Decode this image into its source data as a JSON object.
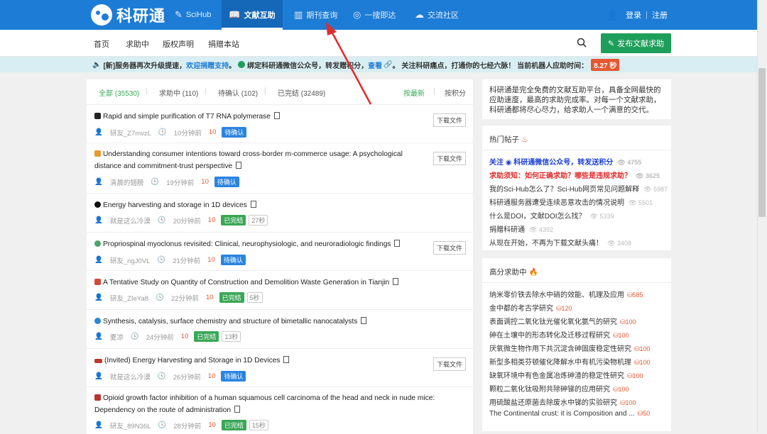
{
  "brand": {
    "name": "科研通"
  },
  "topnav": {
    "items": [
      {
        "label": "SciHub",
        "icon": "scihub-icon"
      },
      {
        "label": "文献互助",
        "icon": "book-icon",
        "active": true
      },
      {
        "label": "期刊查询",
        "icon": "journal-icon"
      },
      {
        "label": "一搜即达",
        "icon": "search-icon"
      },
      {
        "label": "交流社区",
        "icon": "chat-icon"
      }
    ],
    "login": "登录",
    "sep": "|",
    "register": "注册"
  },
  "subnav": {
    "items": [
      "首页",
      "求助中",
      "版权声明",
      "捐赠本站"
    ],
    "publish": "发布文献求助"
  },
  "notice": {
    "p1": "[新]服务器再次升级提速，",
    "p2": "欢迎捐赠支持",
    "p3": "。",
    "p4": "绑定科研通微信公众号，转发赠积分，",
    "p5": "查看",
    "p6": "。 关注科研痛点，打通你的七经六脉！ 当前机器人应助时间：",
    "timer": "8.27 秒"
  },
  "tabs": {
    "all": "全部 (35530)",
    "pending": "求助中 (110)",
    "confirming": "待确认 (102)",
    "done": "已完结 (32489)",
    "sort_new": "按最新",
    "sort_points": "按积分",
    "sep": "|"
  },
  "posts": [
    {
      "title": "Rapid and simple purification of T7 RNA polymerase",
      "user": "研友_Z7mvzL",
      "time": "10分钟前",
      "points": "10",
      "status": "待确认",
      "download": "下载文件"
    },
    {
      "title": "Understanding consumer intentions toward cross-border m-commerce usage: A psychological distance and commitment-trust perspective",
      "user": "清晨的翅膀",
      "time": "19分钟前",
      "points": "10",
      "status": "待确认",
      "download": "下载文件"
    },
    {
      "title": "Energy harvesting and storage in 1D devices",
      "user": "就是这么冷漠",
      "time": "20分钟前",
      "points": "10",
      "status": "已完结",
      "elapsed": "27秒"
    },
    {
      "title": "Propriospinal myoclonus revisited: Clinical, neurophysiologic, and neuroradiologic findings",
      "user": "研友_ngJ0VL",
      "time": "21分钟前",
      "points": "10",
      "status": "待确认",
      "download": "下载文件"
    },
    {
      "title": "A Tentative Study on Quantity of Construction and Demolition Waste Generation in Tianjin",
      "user": "研友_ZIeYa8",
      "time": "22分钟前",
      "points": "10",
      "status": "已完结",
      "elapsed": "5秒"
    },
    {
      "title": "Synthesis, catalysis, surface chemistry and structure of bimetallic nanocatalysts",
      "user": "夏凉",
      "time": "24分钟前",
      "points": "10",
      "status": "已完结",
      "elapsed": "13秒"
    },
    {
      "title": "(Invited) Energy Harvesting and Storage in 1D Devices",
      "user": "就是这么冷漠",
      "time": "26分钟前",
      "points": "10",
      "status": "待确认",
      "download": "下载文件"
    },
    {
      "title": "Opioid growth factor inhibition of a human squamous cell carcinoma of the head and neck in nude mice: Dependency on the route of administration",
      "user": "研友_89N36L",
      "time": "28分钟前",
      "points": "10",
      "status": "已完结",
      "elapsed": "15秒"
    }
  ],
  "sidebar": {
    "intro": "科研通是完全免费的文献互助平台，具备全网最快的应助速度，最高的求助完成率。对每一个文献求助，科研通都将尽心尽力，给求助人一个满意的交代。",
    "hot_title": "热门帖子",
    "hot": [
      {
        "text": "关注 ◉ 科研通微信公众号，转发送积分",
        "views": "4755"
      },
      {
        "text": "求助须知：如何正确求助？哪些是违规求助？",
        "views": "3625"
      },
      {
        "text": "我的Sci-Hub怎么了？Sci-Hub网页常见问题解释",
        "views": "5987"
      },
      {
        "text": "科研通服务器遭受连续恶意攻击的情况说明",
        "views": "5501"
      },
      {
        "text": "什么是DOI，文献DOI怎么找？",
        "views": "5339"
      },
      {
        "text": "捐赠科研通",
        "views": "4392"
      },
      {
        "text": "从现在开始，不再为下载文献头痛！",
        "views": "3408"
      }
    ],
    "req_title": "高分求助中",
    "requests": [
      {
        "text": "纳米零价铁去除水中硝的效能、机理及应用",
        "points": "585"
      },
      {
        "text": "金中都的考古学研究",
        "points": "120"
      },
      {
        "text": "表面调控二氧化钛光催化氧化氨气的研究",
        "points": "100"
      },
      {
        "text": "砷在土壤中的形态转化及迁移过程研究",
        "points": "100"
      },
      {
        "text": "厌氧微生物作用下共沉淀含砷固废稳定性研究",
        "points": "100"
      },
      {
        "text": "新型多相类芬顿催化降解水中有机污染物机理",
        "points": "100"
      },
      {
        "text": "缺氧环境中有色金属冶炼砷渣的稳定性研究",
        "points": "100"
      },
      {
        "text": "颗粒二氧化钛吸附共除砷锑的应用研究",
        "points": "100"
      },
      {
        "text": "用硫酸盐还原菌去除废水中锑的实验研究",
        "points": "100"
      },
      {
        "text": "The Continental crust: it is Composition and ...",
        "points": "50"
      }
    ]
  }
}
